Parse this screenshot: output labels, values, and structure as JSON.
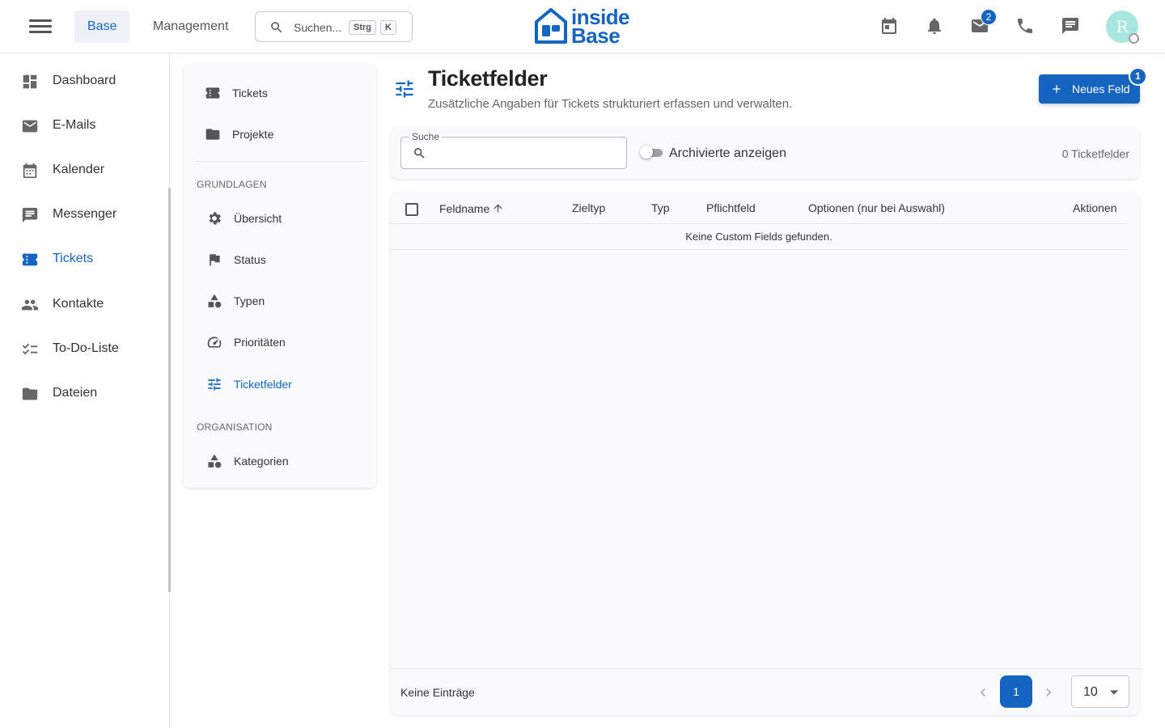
{
  "header": {
    "tabs": [
      "Base",
      "Management"
    ],
    "search_placeholder": "Suchen...",
    "shortcut_keys": [
      "Strg",
      "K"
    ],
    "logo_line1": "inside",
    "logo_line2": "Base",
    "mail_badge": "2",
    "avatar_initial": "R"
  },
  "sidebar": {
    "items": [
      {
        "label": "Dashboard",
        "icon": "dashboard-icon"
      },
      {
        "label": "E-Mails",
        "icon": "mail-icon"
      },
      {
        "label": "Kalender",
        "icon": "calendar-icon"
      },
      {
        "label": "Messenger",
        "icon": "chat-icon"
      },
      {
        "label": "Tickets",
        "icon": "ticket-icon"
      },
      {
        "label": "Kontakte",
        "icon": "contacts-icon"
      },
      {
        "label": "To-Do-Liste",
        "icon": "checklist-icon"
      },
      {
        "label": "Dateien",
        "icon": "folder-icon"
      }
    ],
    "active": "Tickets"
  },
  "panel": {
    "top_items": [
      {
        "label": "Tickets",
        "icon": "ticket-icon"
      },
      {
        "label": "Projekte",
        "icon": "folder-icon"
      }
    ],
    "section1_title": "GRUNDLAGEN",
    "section1_items": [
      {
        "label": "Übersicht",
        "icon": "gear-icon"
      },
      {
        "label": "Status",
        "icon": "flag-icon"
      },
      {
        "label": "Typen",
        "icon": "shapes-icon"
      },
      {
        "label": "Prioritäten",
        "icon": "speedometer-icon"
      },
      {
        "label": "Ticketfelder",
        "icon": "tune-icon"
      }
    ],
    "section2_title": "ORGANISATION",
    "section2_items": [
      {
        "label": "Kategorien",
        "icon": "shapes-icon"
      }
    ],
    "active": "Ticketfelder"
  },
  "main": {
    "title": "Ticketfelder",
    "subtitle": "Zusätzliche Angaben für Tickets strukturiert erfassen und verwalten.",
    "new_button": "Neues Feld",
    "new_badge": "1",
    "search_label": "Suche",
    "search_value": "",
    "archive_toggle_label": "Archivierte anzeigen",
    "archive_toggle_on": false,
    "count_label": "0 Ticketfelder",
    "columns": [
      "Feldname",
      "Zieltyp",
      "Typ",
      "Pflichtfeld",
      "Optionen (nur bei Auswahl)",
      "Aktionen"
    ],
    "sort_column": "Feldname",
    "empty_message": "Keine Custom Fields gefunden.",
    "footer_label": "Keine Einträge",
    "current_page": "1",
    "per_page": "10"
  },
  "colors": {
    "accent": "#1565c0",
    "avatar": "#a8e6e0"
  }
}
